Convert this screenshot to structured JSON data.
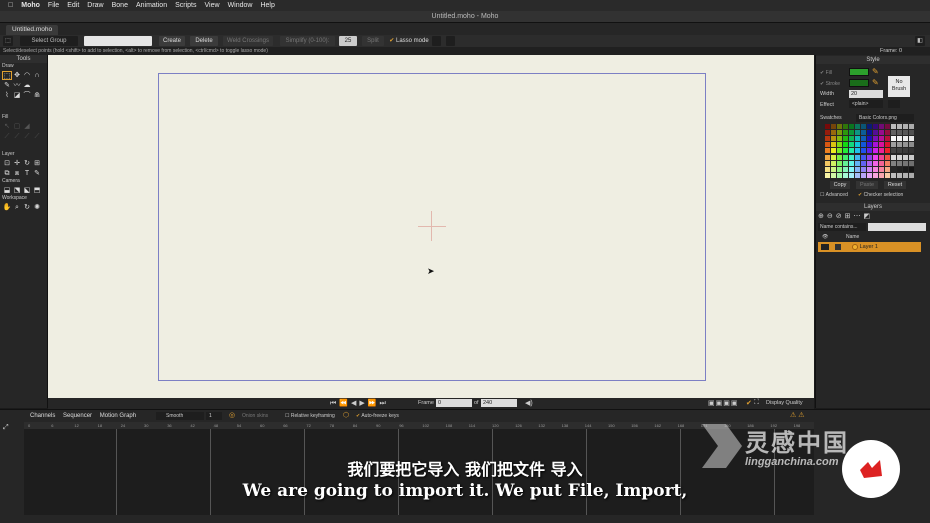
{
  "menubar": {
    "apple": "",
    "app": "Moho",
    "items": [
      "File",
      "Edit",
      "Draw",
      "Bone",
      "Animation",
      "Scripts",
      "View",
      "Window",
      "Help"
    ]
  },
  "window": {
    "title": "Untitled.moho - Moho",
    "tab": "Untitled.moho"
  },
  "toolbar": {
    "select_group": "Select Group",
    "create": "Create",
    "delete": "Delete",
    "weld_crossings": "Weld Crossings",
    "simplify": "Simplify (0-100):",
    "simplify_value": "25",
    "split": "Split",
    "lasso_mode": "Lasso mode",
    "frame_label": "Frame: 0"
  },
  "hint": "Select/deselect points (hold <shift> to add to selection, <alt> to remove from selection, <ctrl/cmd> to toggle lasso mode)",
  "tools": {
    "title": "Tools",
    "sections": [
      "Draw",
      "Fill",
      "Layer",
      "Camera",
      "Workspace"
    ]
  },
  "playback": {
    "frame_label": "Frame",
    "frame_value": "0",
    "of_label": "of",
    "end_value": "240",
    "display_quality": "Display Quality"
  },
  "style": {
    "title": "Style",
    "fill_label": "Fill",
    "stroke_label": "Stroke",
    "width_label": "Width",
    "width_value": "20",
    "effect_label": "Effect",
    "effect_value": "<plain>",
    "no_brush": "No Brush",
    "swatches_label": "Swatches",
    "swatches_file": "Basic Colors.png",
    "copy": "Copy",
    "paste": "Paste",
    "reset": "Reset",
    "advanced": "Advanced",
    "checker_selection": "Checker selection",
    "fill_color": "#2ca02c",
    "stroke_color": "#1a6e1a"
  },
  "layers": {
    "title": "Layers",
    "filter": "Name contains...",
    "name_header": "Name",
    "layer_1": "Layer 1"
  },
  "timeline": {
    "tabs": [
      "Channels",
      "Sequencer",
      "Motion Graph"
    ],
    "smooth": "Smooth",
    "step": "1",
    "onion_skins": "Onion skins",
    "relative_keyframing": "Relative keyframing",
    "auto_freeze": "Auto-freeze keys",
    "ruler": [
      "0",
      "6",
      "12",
      "18",
      "24",
      "30",
      "36",
      "42",
      "48",
      "54",
      "60",
      "66",
      "72",
      "78",
      "84",
      "90",
      "96",
      "102",
      "108",
      "114",
      "120",
      "126",
      "132",
      "138",
      "144",
      "150",
      "156",
      "162",
      "168",
      "174",
      "180",
      "186",
      "192",
      "198"
    ]
  },
  "subtitles": {
    "cn": "我们要把它导入 我们把文件 导入",
    "en": "We are going to import it. We put File, Import,"
  },
  "watermark": {
    "brand": "灵感中国",
    "url": "lingganchina.com"
  }
}
